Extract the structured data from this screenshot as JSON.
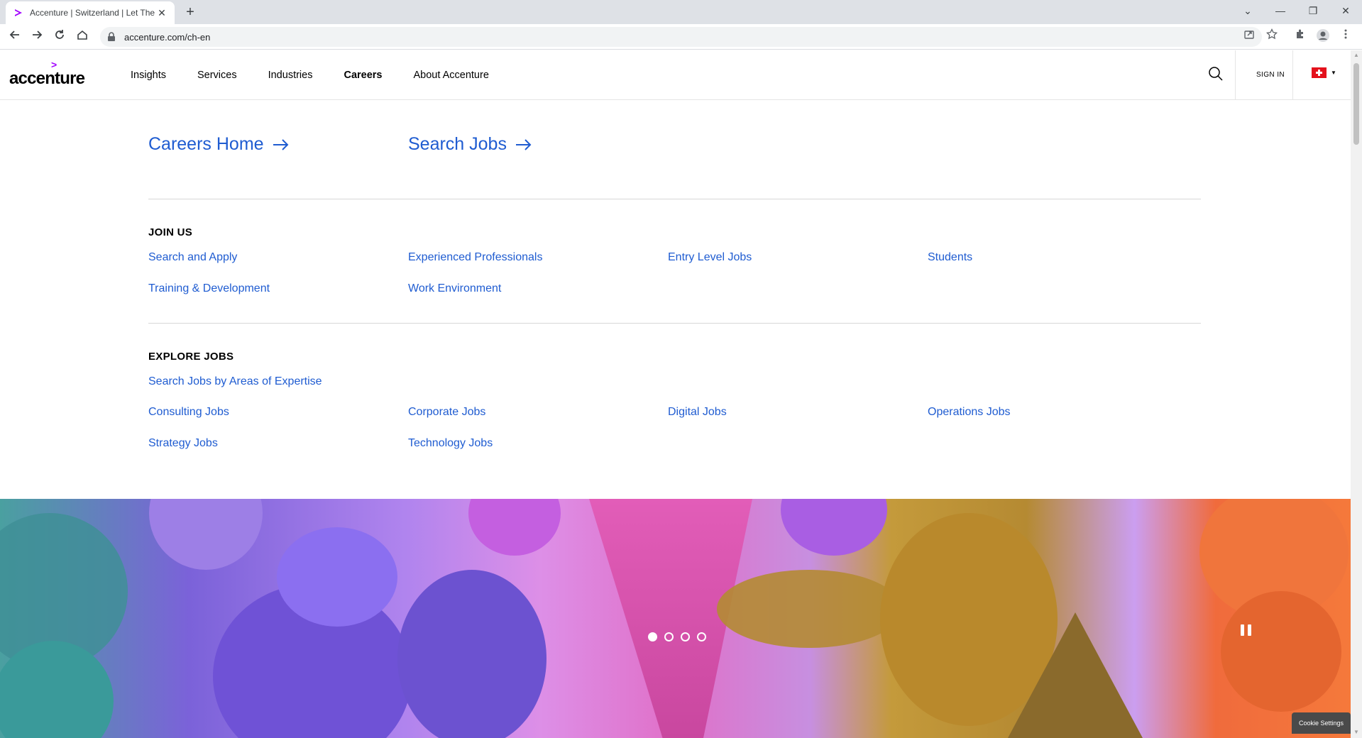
{
  "browser": {
    "tab_title": "Accenture | Switzerland | Let There",
    "tab_close": "✕",
    "new_tab": "+",
    "url": "accenture.com/ch-en",
    "controls": {
      "chevron": "⌄",
      "minimize": "—",
      "restore": "❐",
      "close": "✕"
    },
    "icons": [
      "back-icon",
      "forward-icon",
      "reload-icon",
      "home-icon",
      "lock-icon",
      "share-icon",
      "star-icon",
      "extensions-icon",
      "profile-icon",
      "kebab-menu-icon"
    ]
  },
  "header": {
    "logo_mark": ">",
    "logo_text": "accenture",
    "nav": [
      "Insights",
      "Services",
      "Industries",
      "Careers",
      "About Accenture"
    ],
    "active_nav": "Careers",
    "sign_in": "SIGN IN",
    "flag_caret": "▼"
  },
  "megamenu": {
    "careers_home": "Careers Home",
    "search_jobs": "Search Jobs",
    "join_us": {
      "title": "JOIN US",
      "links": [
        "Search and Apply",
        "Experienced Professionals",
        "Entry Level Jobs",
        "Students",
        "Training & Development",
        "Work Environment"
      ]
    },
    "explore_jobs": {
      "title": "EXPLORE JOBS",
      "expertise_link": "Search Jobs by Areas of Expertise",
      "links": [
        "Consulting Jobs",
        "Corporate Jobs",
        "Digital Jobs",
        "Operations Jobs",
        "Strategy Jobs",
        "Technology Jobs"
      ]
    }
  },
  "hero": {
    "slides": 4,
    "active_slide": 1
  },
  "cookie_settings": "Cookie Settings",
  "colors": {
    "accent_purple": "#a100ff",
    "link_blue": "#1f5cd1"
  }
}
